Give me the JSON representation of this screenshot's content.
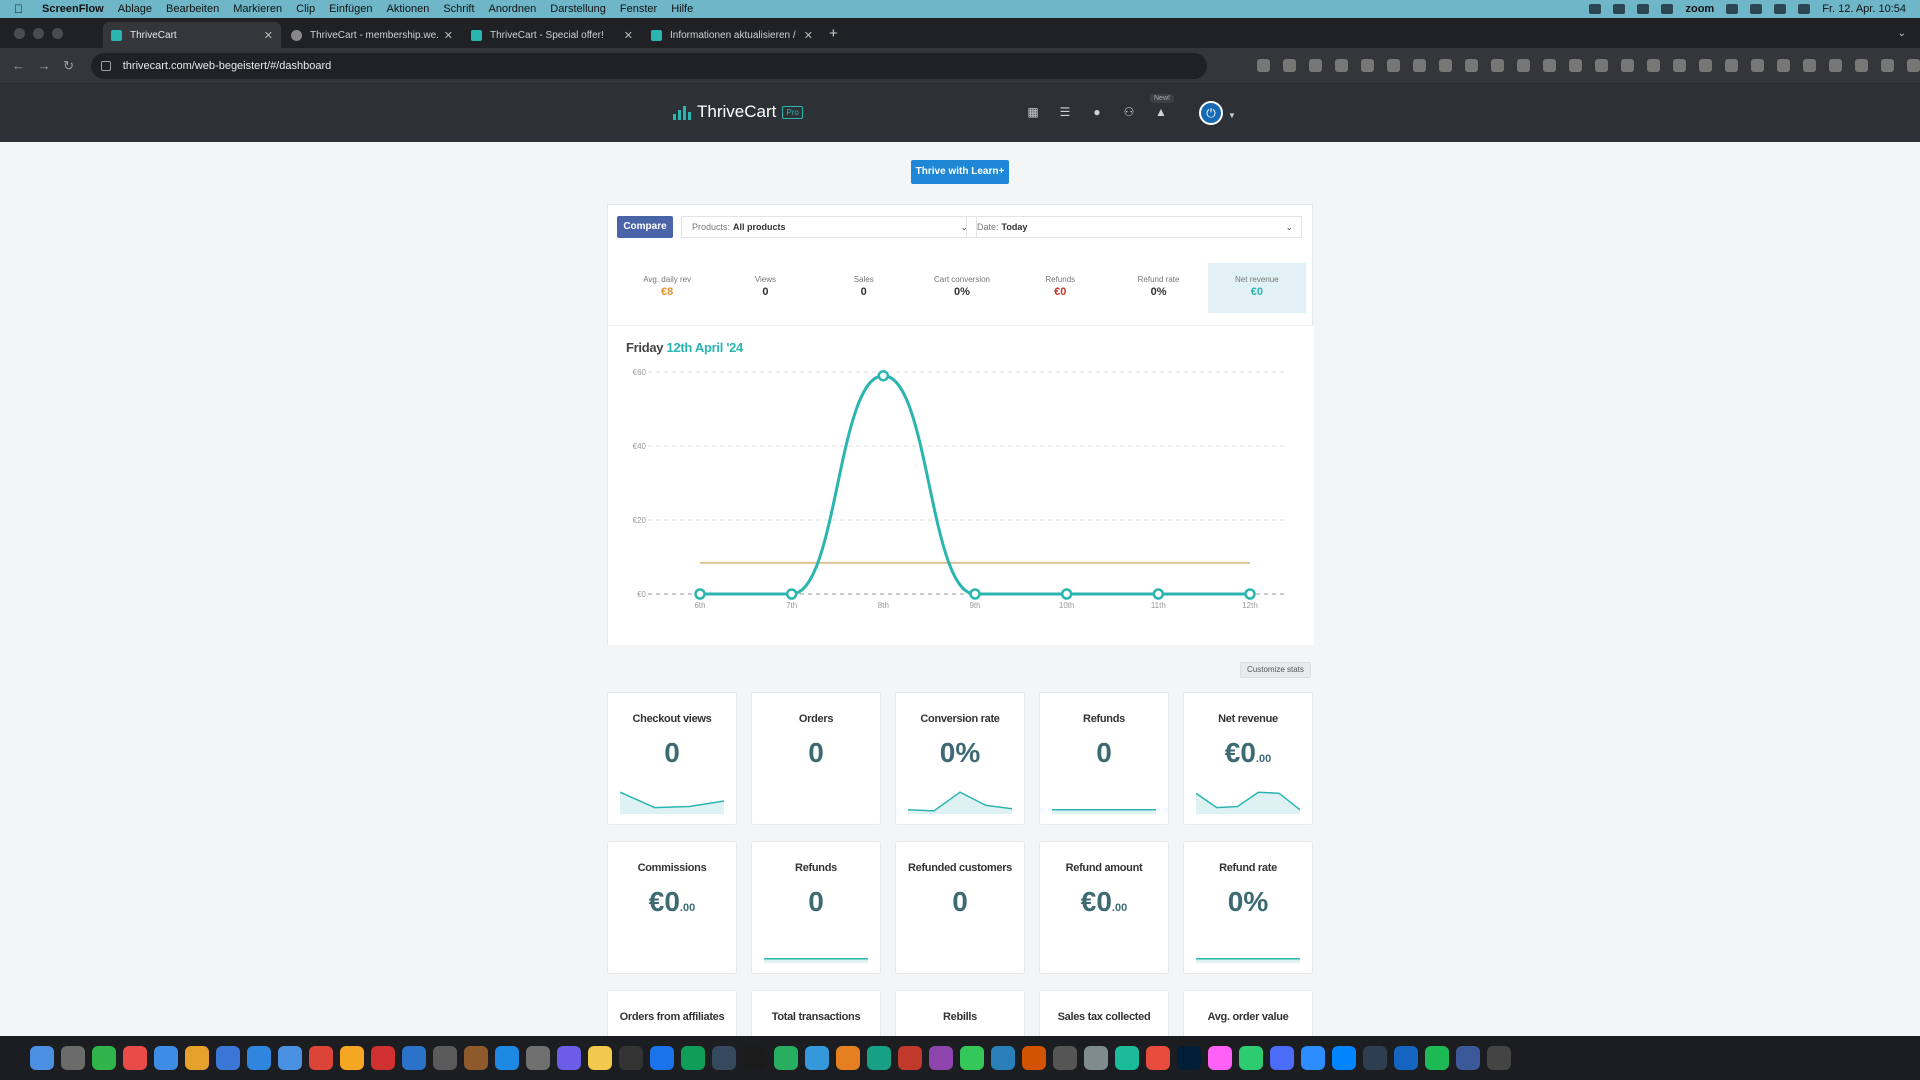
{
  "menubar": {
    "app": "ScreenFlow",
    "items": [
      "Ablage",
      "Bearbeiten",
      "Markieren",
      "Clip",
      "Einfügen",
      "Aktionen",
      "Schrift",
      "Anordnen",
      "Darstellung",
      "Fenster",
      "Hilfe"
    ],
    "zoom": "zoom",
    "datetime": "Fr. 12. Apr. 10:54"
  },
  "browser": {
    "tabs": [
      {
        "title": "ThriveCart",
        "active": true
      },
      {
        "title": "ThriveCart - membership.we...",
        "active": false
      },
      {
        "title": "ThriveCart - Special offer!",
        "active": false
      },
      {
        "title": "Informationen aktualisieren /",
        "active": false
      }
    ],
    "new_tab": "+",
    "url": "thrivecart.com/web-begeistert/#/dashboard"
  },
  "header": {
    "brand": "ThriveCart",
    "badge": "Pro",
    "new_label": "New!"
  },
  "learn_button": "Thrive with Learn+",
  "filters": {
    "compare": "Compare",
    "products_label": "Products:",
    "products_value": "All products",
    "date_label": "Date:",
    "date_value": "Today"
  },
  "summary": [
    {
      "label": "Avg. daily rev",
      "value": "€8",
      "color": "#e0952e"
    },
    {
      "label": "Views",
      "value": "0",
      "color": "#333333"
    },
    {
      "label": "Sales",
      "value": "0",
      "color": "#333333"
    },
    {
      "label": "Cart conversion",
      "value": "0%",
      "color": "#333333"
    },
    {
      "label": "Refunds",
      "value": "€0",
      "color": "#c0392b"
    },
    {
      "label": "Refund rate",
      "value": "0%",
      "color": "#333333"
    },
    {
      "label": "Net revenue",
      "value": "€0",
      "color": "#2bb5b0"
    }
  ],
  "chart_title": {
    "day": "Friday",
    "date": "12th April '24"
  },
  "chart_data": {
    "type": "line",
    "x": [
      "6th",
      "7th",
      "8th",
      "9th",
      "10th",
      "11th",
      "12th"
    ],
    "series": [
      {
        "values": [
          0,
          0,
          59,
          0,
          0,
          0,
          0
        ],
        "color": "#2bb5b0"
      }
    ],
    "average": 8.4,
    "average_color": "#d6b27a",
    "ylim": [
      0,
      60
    ],
    "yticks": [
      "€0",
      "€20",
      "€40",
      "€60"
    ],
    "grid": true
  },
  "customize": "Customize stats",
  "cards_row1": [
    {
      "title": "Checkout views",
      "int": "0",
      "dec": "",
      "spark": [
        0.9,
        0.2,
        0.25,
        0.5
      ]
    },
    {
      "title": "Orders",
      "int": "0",
      "dec": "",
      "spark": []
    },
    {
      "title": "Conversion rate",
      "int": "0%",
      "dec": "",
      "spark": [
        0.1,
        0.05,
        0.9,
        0.3,
        0.15
      ]
    },
    {
      "title": "Refunds",
      "int": "0",
      "dec": "",
      "spark": [
        0.1,
        0.1
      ]
    },
    {
      "title": "Net revenue",
      "int": "€0",
      "dec": ".00",
      "spark": [
        0.85,
        0.2,
        0.25,
        0.9,
        0.85,
        0.1
      ]
    }
  ],
  "cards_row2": [
    {
      "title": "Commissions",
      "int": "€0",
      "dec": ".00",
      "spark": []
    },
    {
      "title": "Refunds",
      "int": "0",
      "dec": "",
      "spark": [
        0.1,
        0.1
      ]
    },
    {
      "title": "Refunded customers",
      "int": "0",
      "dec": "",
      "spark": []
    },
    {
      "title": "Refund amount",
      "int": "€0",
      "dec": ".00",
      "spark": []
    },
    {
      "title": "Refund rate",
      "int": "0%",
      "dec": "",
      "spark": [
        0.1,
        0.1
      ]
    }
  ],
  "cards_row3": [
    {
      "title": "Orders from affiliates"
    },
    {
      "title": "Total transactions"
    },
    {
      "title": "Rebills"
    },
    {
      "title": "Sales tax collected"
    },
    {
      "title": "Avg. order value"
    }
  ]
}
